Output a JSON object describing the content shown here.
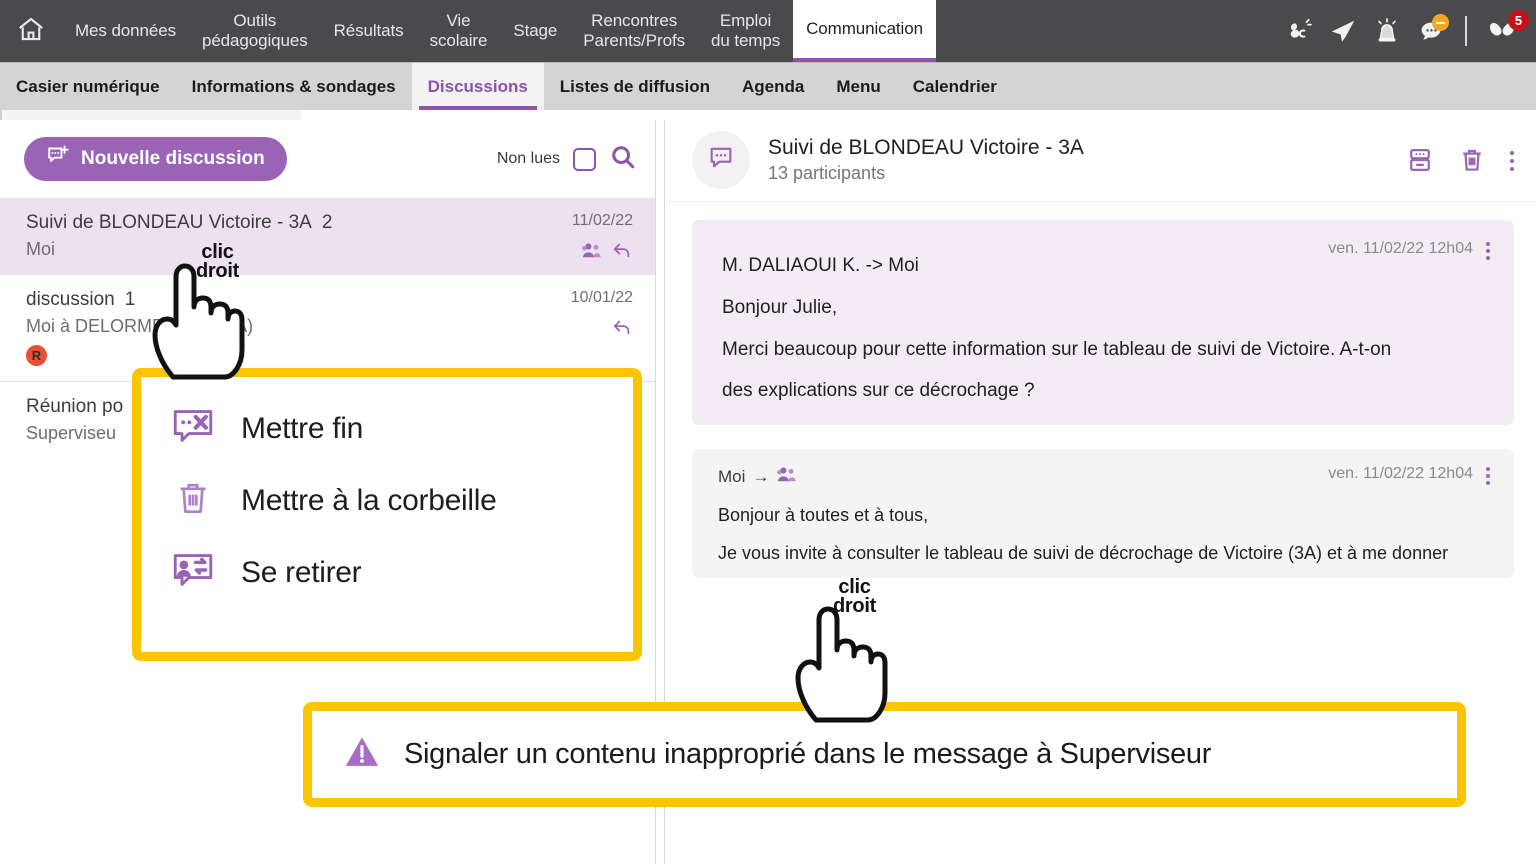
{
  "topnav": {
    "home_icon": "home-icon",
    "items": [
      {
        "label": "Mes données",
        "active": false
      },
      {
        "label": "Outils\npédagogiques",
        "active": false
      },
      {
        "label": "Résultats",
        "active": false
      },
      {
        "label": "Vie\nscolaire",
        "active": false
      },
      {
        "label": "Stage",
        "active": false
      },
      {
        "label": "Rencontres\nParents/Profs",
        "active": false
      },
      {
        "label": "Emploi\ndu temps",
        "active": false
      },
      {
        "label": "Communication",
        "active": true
      }
    ],
    "icons": [
      {
        "name": "clover-badge-icon"
      },
      {
        "name": "paper-plane-icon"
      },
      {
        "name": "alarm-siren-icon"
      },
      {
        "name": "chat-notification-icon",
        "badge": "minus"
      },
      {
        "name": "butterfly-logo-icon",
        "badge_count": "5"
      }
    ]
  },
  "subnav": {
    "items": [
      {
        "label": "Casier numérique",
        "active": false
      },
      {
        "label": "Informations & sondages",
        "active": false
      },
      {
        "label": "Discussions",
        "active": true
      },
      {
        "label": "Listes de diffusion",
        "active": false
      },
      {
        "label": "Agenda",
        "active": false
      },
      {
        "label": "Menu",
        "active": false
      },
      {
        "label": "Calendrier",
        "active": false
      }
    ]
  },
  "left_panel": {
    "new_discussion_label": "Nouvelle discussion",
    "new_discussion_icon": "new-message-icon",
    "unread_filter_label": "Non lues",
    "unread_checkbox_checked": false,
    "search_icon": "search-icon",
    "discussions": [
      {
        "title": "Suivi de BLONDEAU Victoire - 3A",
        "count": "2",
        "subtitle": "Moi",
        "date": "11/02/22",
        "icons": [
          "group-icon",
          "reply-arrow-icon"
        ],
        "selected": true,
        "badge": ""
      },
      {
        "title": "discussion",
        "count": "1",
        "subtitle": "Moi à DELORME Anaïs (3A)",
        "date": "10/01/22",
        "icons": [
          "reply-arrow-icon"
        ],
        "selected": false,
        "badge": "R"
      },
      {
        "title": "Réunion po",
        "count": "",
        "subtitle": "Superviseu",
        "date": "",
        "icons": [],
        "selected": false,
        "badge": ""
      }
    ]
  },
  "conversation": {
    "avatar_icon": "chat-bubble-icon",
    "title": "Suivi de BLONDEAU Victoire - 3A",
    "participants": "13 participants",
    "actions": [
      {
        "name": "archive-icon"
      },
      {
        "name": "trash-icon"
      },
      {
        "name": "kebab-menu-icon"
      }
    ],
    "messages": [
      {
        "direction": "incoming",
        "from": "M. DALIAOUI K. -> Moi",
        "time": "ven. 11/02/22 12h04",
        "lines": [
          "Bonjour Julie,",
          "Merci beaucoup pour cette information sur le tableau de suivi de Victoire. A-t-on",
          "des explications sur ce décrochage ?"
        ]
      },
      {
        "direction": "outgoing",
        "from": "Moi",
        "from_arrow": "→",
        "from_icon": "group-icon",
        "time": "ven. 11/02/22 12h04",
        "lines": [
          "Bonjour à toutes et à tous,",
          "Je vous invite à consulter le tableau de suivi de décrochage de Victoire (3A) et à me donner"
        ]
      }
    ]
  },
  "context_menu": {
    "items": [
      {
        "label": "Mettre fin",
        "icon": "end-discussion-icon"
      },
      {
        "label": "Mettre à la corbeille",
        "icon": "trash-icon"
      },
      {
        "label": "Se retirer",
        "icon": "leave-discussion-icon"
      }
    ]
  },
  "report_callout": {
    "icon": "warning-triangle-icon",
    "label": "Signaler un contenu inapproprié dans le message à Superviseur"
  },
  "cursor_annotations": [
    {
      "line1": "clic",
      "line2": "droit"
    },
    {
      "line1": "clic",
      "line2": "droit"
    }
  ],
  "colors": {
    "brand_purple": "#8e52a8",
    "button_purple": "#9a63b5",
    "topnav_grey": "#4a4a4d",
    "subnav_grey": "#d4d4d4",
    "selected_row": "#ece0f1",
    "incoming_bubble": "#f3ecf5",
    "outgoing_bubble": "#f4f4f4",
    "callout_yellow": "#fdc500",
    "badge_red": "#c4111b",
    "r_badge_red": "#ea4f35",
    "orange_dot": "#f5a623"
  }
}
